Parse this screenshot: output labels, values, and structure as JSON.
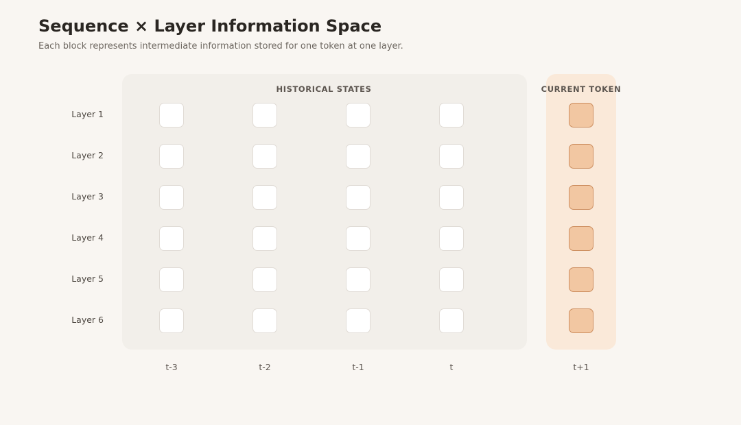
{
  "header": {
    "title": "Sequence × Layer Information Space",
    "subtitle": "Each block represents intermediate information stored for one token at one layer."
  },
  "sections": {
    "historical_label": "HISTORICAL STATES",
    "current_label": "CURRENT TOKEN"
  },
  "rows": [
    "Layer 1",
    "Layer 2",
    "Layer 3",
    "Layer 4",
    "Layer 5",
    "Layer 6"
  ],
  "columns": {
    "historical": [
      "t-3",
      "t-2",
      "t-1",
      "t"
    ],
    "current": [
      "t+1"
    ]
  },
  "colors": {
    "background": "#f9f6f2",
    "historical_panel": "#f2efea",
    "current_panel": "#fae9d9",
    "historical_block": "#ffffff",
    "current_block": "#f2c7a2",
    "current_block_border": "#cc8d5e"
  }
}
